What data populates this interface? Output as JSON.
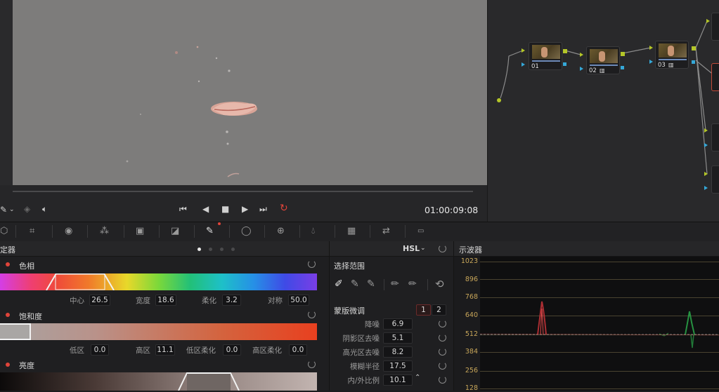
{
  "transport": {
    "timecode": "01:00:09:08"
  },
  "nodes": [
    {
      "label": "01"
    },
    {
      "label": "02"
    },
    {
      "label": "03"
    }
  ],
  "qualifier": {
    "title_partial": "定器",
    "mode": "HSL",
    "hue": {
      "title": "色相",
      "fields": [
        {
          "label": "中心",
          "value": "26.5"
        },
        {
          "label": "宽度",
          "value": "18.6"
        },
        {
          "label": "柔化",
          "value": "3.2"
        },
        {
          "label": "对称",
          "value": "50.0"
        }
      ]
    },
    "saturation": {
      "title": "饱和度",
      "fields": [
        {
          "label": "低区",
          "value": "0.0"
        },
        {
          "label": "高区",
          "value": "11.1"
        },
        {
          "label": "低区柔化",
          "value": "0.0"
        },
        {
          "label": "高区柔化",
          "value": "0.0"
        }
      ]
    },
    "luminance": {
      "title": "亮度"
    }
  },
  "selection": {
    "title": "选择范围",
    "matte_title": "蒙版微调",
    "tabs": [
      "1",
      "2"
    ],
    "params": [
      {
        "label": "降噪",
        "value": "6.9"
      },
      {
        "label": "阴影区去噪",
        "value": "5.1"
      },
      {
        "label": "高光区去噪",
        "value": "8.2"
      },
      {
        "label": "模糊半径",
        "value": "17.5"
      },
      {
        "label": "内/外比例",
        "value": "10.1"
      }
    ]
  },
  "scope": {
    "title": "示波器",
    "y_labels": [
      "1023",
      "896",
      "768",
      "640",
      "512",
      "384",
      "256",
      "128"
    ]
  },
  "colors": {
    "accent_red": "#e0443a",
    "scope_label": "#c9a75a",
    "node_port": "#b4c628"
  }
}
